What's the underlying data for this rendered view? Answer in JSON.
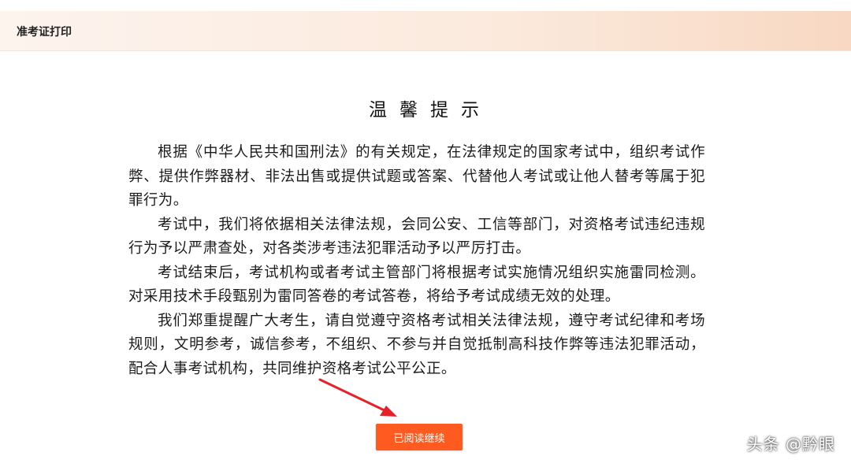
{
  "header": {
    "title": "准考证打印"
  },
  "notice": {
    "title": "温馨提示",
    "paragraphs": [
      "根据《中华人民共和国刑法》的有关规定，在法律规定的国家考试中，组织考试作弊、提供作弊器材、非法出售或提供试题或答案、代替他人考试或让他人替考等属于犯罪行为。",
      "考试中，我们将依据相关法律法规，会同公安、工信等部门，对资格考试违纪违规行为予以严肃查处，对各类涉考违法犯罪活动予以严厉打击。",
      "考试结束后，考试机构或者考试主管部门将根据考试实施情况组织实施雷同检测。对采用技术手段甄别为雷同答卷的考试答卷，将给予考试成绩无效的处理。",
      "我们郑重提醒广大考生，请自觉遵守资格考试相关法律法规，遵守考试纪律和考场规则，文明参考，诚信参考，不组织、不参与并自觉抵制高科技作弊等违法犯罪活动，配合人事考试机构，共同维护资格考试公平公正。"
    ]
  },
  "actions": {
    "continue_label": "已阅读继续"
  },
  "watermark": {
    "text": "头条 @黔眼"
  },
  "colors": {
    "button": "#ff5a1f",
    "arrow": "#e8202a",
    "header_gradient_end": "#f8d8c2"
  }
}
